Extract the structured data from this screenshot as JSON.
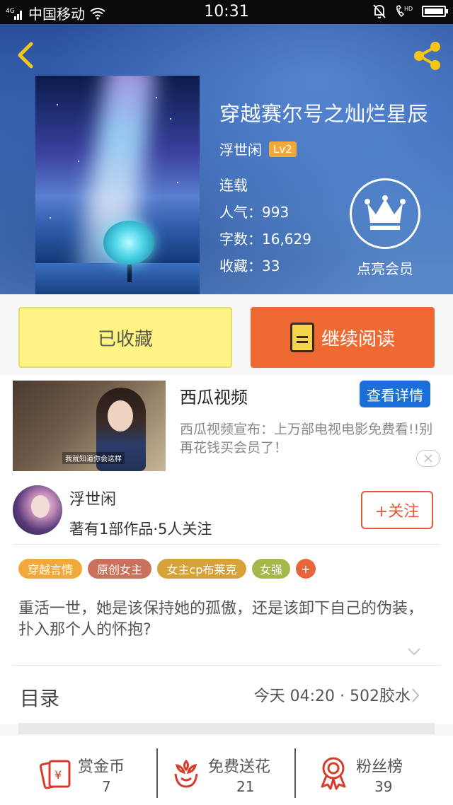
{
  "status_bar": {
    "network": "4G",
    "carrier": "中国移动",
    "time": "10:31",
    "battery_level": 0.85
  },
  "book": {
    "title": "穿越赛尔号之灿烂星辰",
    "author": "浮世闲",
    "level": "Lv2",
    "status": "连载",
    "popularity": "人气：993",
    "word_count": "字数：16,629",
    "favorites": "收藏：33"
  },
  "vip": {
    "label": "点亮会员",
    "icon": "crown-icon"
  },
  "actions": {
    "collected_label": "已收藏",
    "continue_label": "继续阅读"
  },
  "ad": {
    "title": "西瓜视频",
    "button_label": "查看详情",
    "description": "西瓜视频宣布：上万部电视电影免费看!!别再花钱买会员了！",
    "thumb_caption": "我就知道你会这样"
  },
  "author_card": {
    "name": "浮世闲",
    "stats": "著有1部作品·5人关注",
    "follow_label": "+关注"
  },
  "tags": [
    {
      "label": "穿越言情",
      "color": "#f2a93b"
    },
    {
      "label": "原创女主",
      "color": "#c9715c"
    },
    {
      "label": "女主cp布莱克",
      "color": "#d8a23a"
    },
    {
      "label": "女强",
      "color": "#a2b84a"
    },
    {
      "label": "+",
      "color": "#e8643a"
    }
  ],
  "synopsis": "重活一世，她是该保持她的孤傲，还是该卸下自己的伪装，扑入那个人的怀抱?",
  "toc": {
    "title": "目录",
    "latest": "今天 04:20 · 502胶水"
  },
  "bottom_actions": [
    {
      "label": "赏金币",
      "count": "7",
      "icon": "red-envelope-icon"
    },
    {
      "label": "免费送花",
      "count": "21",
      "icon": "flower-icon"
    },
    {
      "label": "粉丝榜",
      "count": "39",
      "icon": "award-ribbon-icon"
    }
  ],
  "colors": {
    "accent_orange": "#ef6a33",
    "accent_red": "#e15a39",
    "collected_yellow": "#fff385",
    "ad_blue": "#1a6fd9",
    "icon_red": "#d83a2b"
  }
}
